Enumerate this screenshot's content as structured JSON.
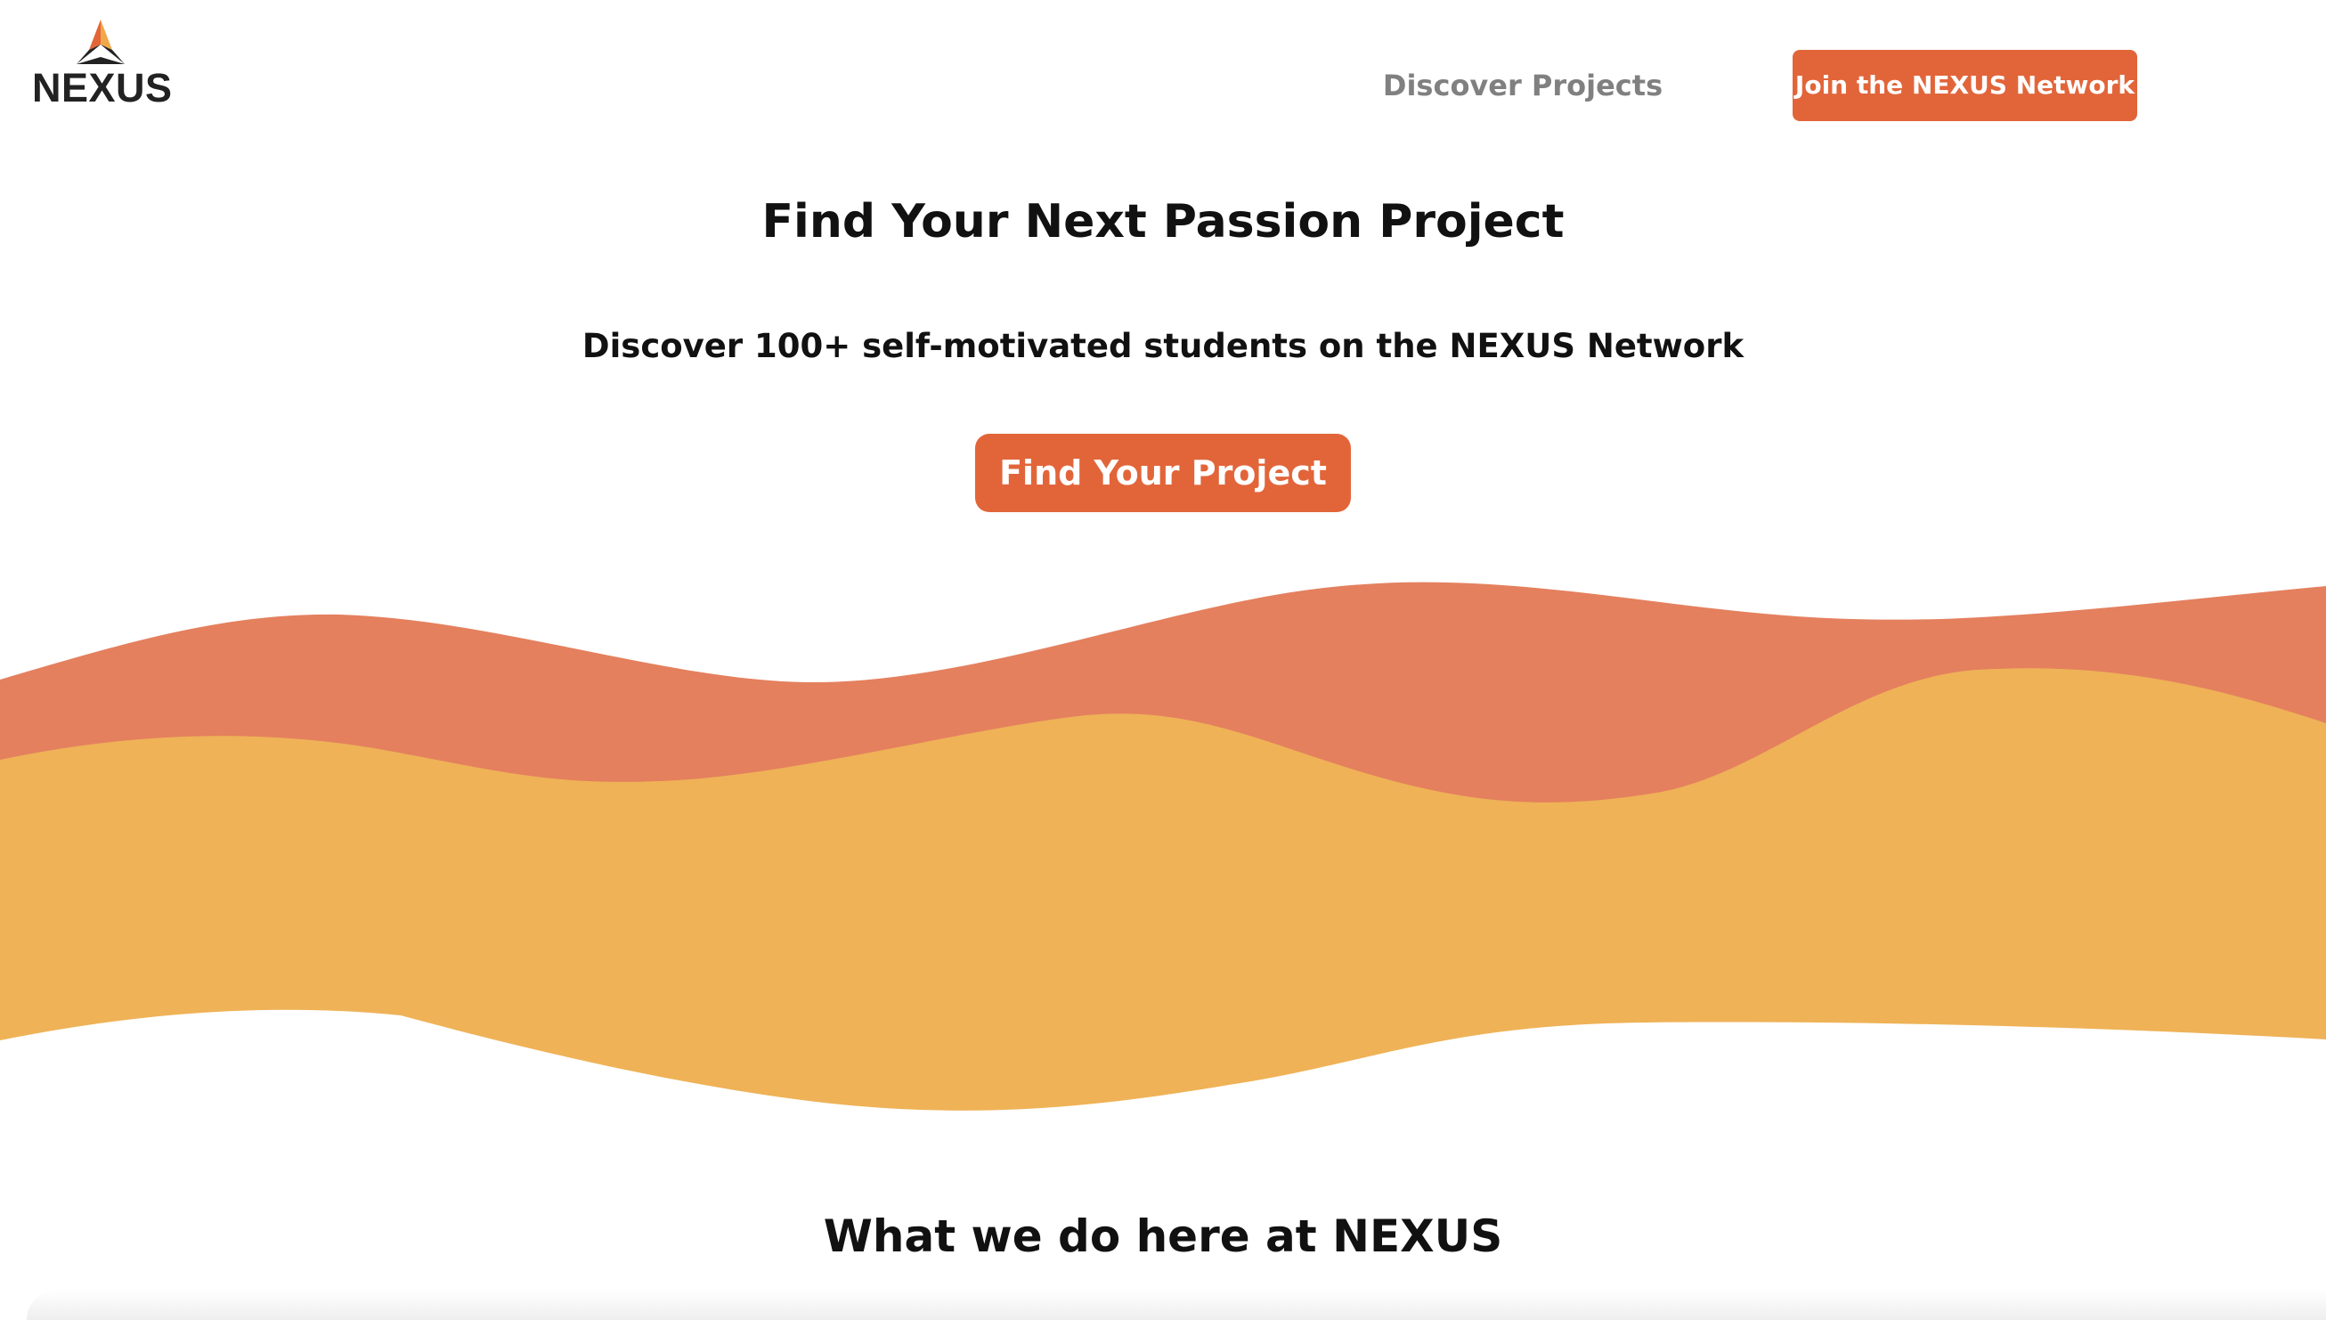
{
  "header": {
    "logo_text": "NEXUS",
    "logo_icon": "triangle-logo-icon",
    "nav_link": "Discover Projects",
    "cta_label": "Join the NEXUS Network"
  },
  "hero": {
    "title": "Find Your Next Passion Project",
    "subtitle": "Discover 100+ self-motivated students on the NEXUS Network",
    "button_label": "Find Your Project"
  },
  "section": {
    "heading": "What we do here at NEXUS"
  },
  "colors": {
    "accent": "#e2653a",
    "wave_top": "#e4805e",
    "wave_bottom": "#efb257",
    "logo_dark": "#222222",
    "logo_gold": "#f0a94a",
    "logo_orange": "#e2653a"
  }
}
